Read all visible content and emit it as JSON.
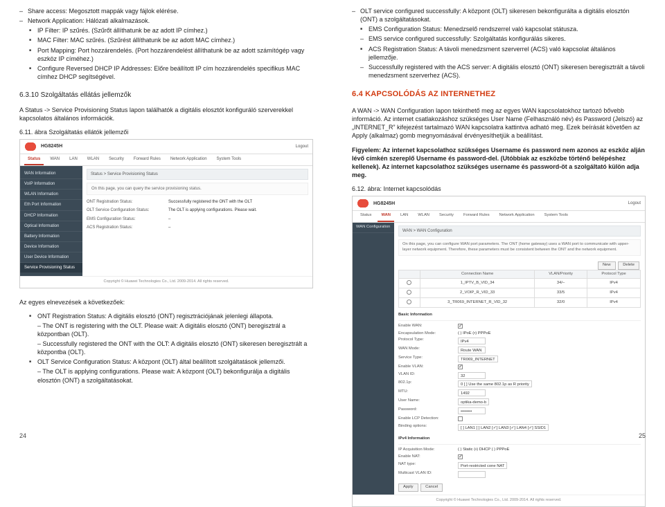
{
  "left": {
    "items": [
      {
        "lvl": "l0",
        "text": "Share access: Megosztott mappák vagy fájlok elérése."
      },
      {
        "lvl": "l0",
        "text": "Network Application: Hálózati alkalmazások."
      },
      {
        "lvl": "l1",
        "text": "IP Filter: IP szűrés. (Szűrőt állíthatunk be az adott IP címhez.)"
      },
      {
        "lvl": "l1",
        "text": "MAC Filter: MAC szűrés. (Szűrést állíthatunk be az adott MAC címhez.)"
      },
      {
        "lvl": "l1",
        "text": "Port Mapping: Port hozzárendelés. (Port hozzárendelést állíthatunk be az adott számítógép vagy eszköz IP címéhez.)"
      },
      {
        "lvl": "l1",
        "text": "Configure Reversed DHCP IP Addresses: Előre beállított IP cím hozzárendelés specifikus MAC címhez DHCP segítségével."
      }
    ],
    "sub_heading": "6.3.10 Szolgáltatás ellátás jellemzők",
    "sub_body": "A Status -> Service Provisioning Status lapon találhatók a digitális elosztót konfiguráló szerverekkel kapcsolatos általános információk.",
    "caption": "6.11. ábra Szolgáltatás ellátók jellemzői",
    "router": {
      "model": "HG8245H",
      "logout": "Logout",
      "tabs": [
        "Status",
        "WAN",
        "LAN",
        "WLAN",
        "Security",
        "Forward Rules",
        "Network Application",
        "System Tools"
      ],
      "active_tab": "Status",
      "sidebar": [
        "WAN Information",
        "VoIP Information",
        "WLAN Information",
        "Eth Port Information",
        "DHCP Information",
        "Optical Information",
        "Battery Information",
        "Device Information",
        "User Device Information",
        "Service Provisioning Status"
      ],
      "sidebar_sel": "Service Provisioning Status",
      "crumb": "Status > Service Provisioning Status",
      "hint": "On this page, you can query the service provisioning status.",
      "rows": [
        {
          "lbl": "ONT Registration Status:",
          "val": "Successfully registered the ONT with the OLT"
        },
        {
          "lbl": "OLT Service Configuration Status:",
          "val": "The OLT is applying configurations. Please wait."
        },
        {
          "lbl": "EMS Configuration Status:",
          "val": "–"
        },
        {
          "lbl": "ACS Registration Status:",
          "val": "–"
        }
      ],
      "footer": "Copyright © Huawei Technologies Co., Ltd. 2009-2014. All rights reserved."
    },
    "below_heading": "Az egyes elnevezések a következőek:",
    "below_items": [
      {
        "lvl": "l1",
        "text": "ONT Registration Status: A digitális elosztó (ONT) regisztrációjának jelenlegi állapota."
      },
      {
        "lvl": "l0p",
        "text": "– The ONT is registering with the OLT. Please wait: A digitális elosztó (ONT) beregisztrál a központban (OLT)."
      },
      {
        "lvl": "l0p",
        "text": "– Successfully registered the ONT with the OLT: A digitális elosztó (ONT) sikeresen beregisztrált a központba (OLT)."
      },
      {
        "lvl": "l1",
        "text": "OLT Service Configuration Status: A központ (OLT) által beállított szolgáltatások jellemzői."
      },
      {
        "lvl": "l0p",
        "text": "– The OLT is applying configurations. Please wait: A központ (OLT) bekonfigurálja a digitális elosztón (ONT) a szolgáltatásokat."
      }
    ],
    "page_num": "24"
  },
  "right": {
    "top_items": [
      {
        "lvl": "r0",
        "text": "OLT service configured successfully: A központ (OLT) sikeresen bekonfigurálta a digitális elosztón (ONT) a szolgáltatásokat."
      },
      {
        "lvl": "r1",
        "text": "EMS Configuration Status: Menedzselő rendszerrel való kapcsolat státusza."
      },
      {
        "lvl": "r2",
        "text": "EMS service configured successfully: Szolgáltatás konfigurálás sikeres."
      },
      {
        "lvl": "r1",
        "text": "ACS Registration Status: A távoli menedzsment szerverrel (ACS) való kapcsolat általános jellemzője."
      },
      {
        "lvl": "r2",
        "text": "Successfully registered with the ACS server: A digitális elosztó (ONT) sikeresen beregisztrált a távoli menedzsment szerverhez (ACS)."
      }
    ],
    "sect": "6.4 KAPCSOLÓDÁS AZ INTERNETHEZ",
    "sect_body": "A WAN -> WAN Configuration lapon tekinthető meg az egyes WAN kapcsolatokhoz tartozó bővebb információ. Az internet csatlakozáshoz szükséges User Name (Felhasználó név) és Password (Jelszó) az „INTERNET_R” kifejezést tartalmazó WAN kapcsolatra kattintva adható meg. Ezek beírását követően az Apply (alkalmaz) gomb megnyomásával érvényesíthetjük a beállítást.",
    "warn": "Figyelem: Az internet kapcsolathoz szükséges Username és password nem azonos az eszköz alján lévő címkén szereplő Username és password-del. (Utóbbiak az eszközbe történő belépéshez kellenek). Az internet kapcsolathoz szükséges username és password-öt a szolgáltató külön adja meg.",
    "caption": "6.12. ábra: Internet kapcsolódás",
    "wan": {
      "model": "HG8245H",
      "logout": "Logout",
      "tabs": [
        "Status",
        "WAN",
        "LAN",
        "WLAN",
        "Security",
        "Forward Rules",
        "Network Application",
        "System Tools"
      ],
      "active_tab": "WAN",
      "sidebar": [
        "WAN Configuration"
      ],
      "crumb": "WAN > WAN Configuration",
      "hint": "On this page, you can configure WAN port parameters. The ONT (home gateway) uses a WAN port to communicate with upper-layer network equipment. Therefore, these parameters must be consistent between the ONT and the network equipment.",
      "new_btn": "New",
      "del_btn": "Delete",
      "table": {
        "headers": [
          "",
          "Connection Name",
          "VLAN/Priority",
          "Protocol Type"
        ],
        "rows": [
          [
            "",
            "1_IPTV_B_VID_34",
            "34/–",
            "IPv4"
          ],
          [
            "",
            "2_VOIP_R_VID_33",
            "33/5",
            "IPv4"
          ],
          [
            "",
            "3_TR069_INTERNET_R_VID_32",
            "32/0",
            "IPv4"
          ]
        ]
      },
      "basic": {
        "title": "Basic Information",
        "rows": [
          {
            "lbl": "Enable WAN:",
            "val": "[chk-on]"
          },
          {
            "lbl": "Encapsulation Mode:",
            "val": "( ) IPoE   (•) PPPoE"
          },
          {
            "lbl": "Protocol Type:",
            "val": "IPv4"
          },
          {
            "lbl": "WAN Mode:",
            "val": "Route WAN"
          },
          {
            "lbl": "Service Type:",
            "val": "TR069_INTERNET"
          },
          {
            "lbl": "Enable VLAN:",
            "val": "[chk-on]"
          },
          {
            "lbl": "VLAN ID:",
            "val": "32"
          },
          {
            "lbl": "802.1p:",
            "val": "0   [ ] Use the same 802.1p as R priority"
          },
          {
            "lbl": "MTU:",
            "val": "1492"
          },
          {
            "lbl": "User Name:",
            "val": "optika-demo-b"
          },
          {
            "lbl": "Password:",
            "val": "••••••••"
          },
          {
            "lbl": "Enable LCP Detection:",
            "val": "[chk]"
          },
          {
            "lbl": "Binding options:",
            "val": "[ ] LAN1 [ ] LAN2 [✓] LAN3 [✓] LAN4 [✓] SSID1"
          }
        ]
      },
      "ipv4": {
        "title": "IPv4 Information",
        "rows": [
          {
            "lbl": "IP Acquisition Mode:",
            "val": "( ) Static  (•) DHCP  ( ) PPPoE"
          },
          {
            "lbl": "Enable NAT:",
            "val": "[chk-on]"
          },
          {
            "lbl": "NAT type:",
            "val": "Port-restricted cone NAT"
          },
          {
            "lbl": "Multicast VLAN ID:",
            "val": ""
          }
        ]
      },
      "apply": "Apply",
      "cancel": "Cancel",
      "footer": "Copyright © Huawei Technologies Co., Ltd. 2009-2014. All rights reserved."
    },
    "page_num": "25"
  }
}
